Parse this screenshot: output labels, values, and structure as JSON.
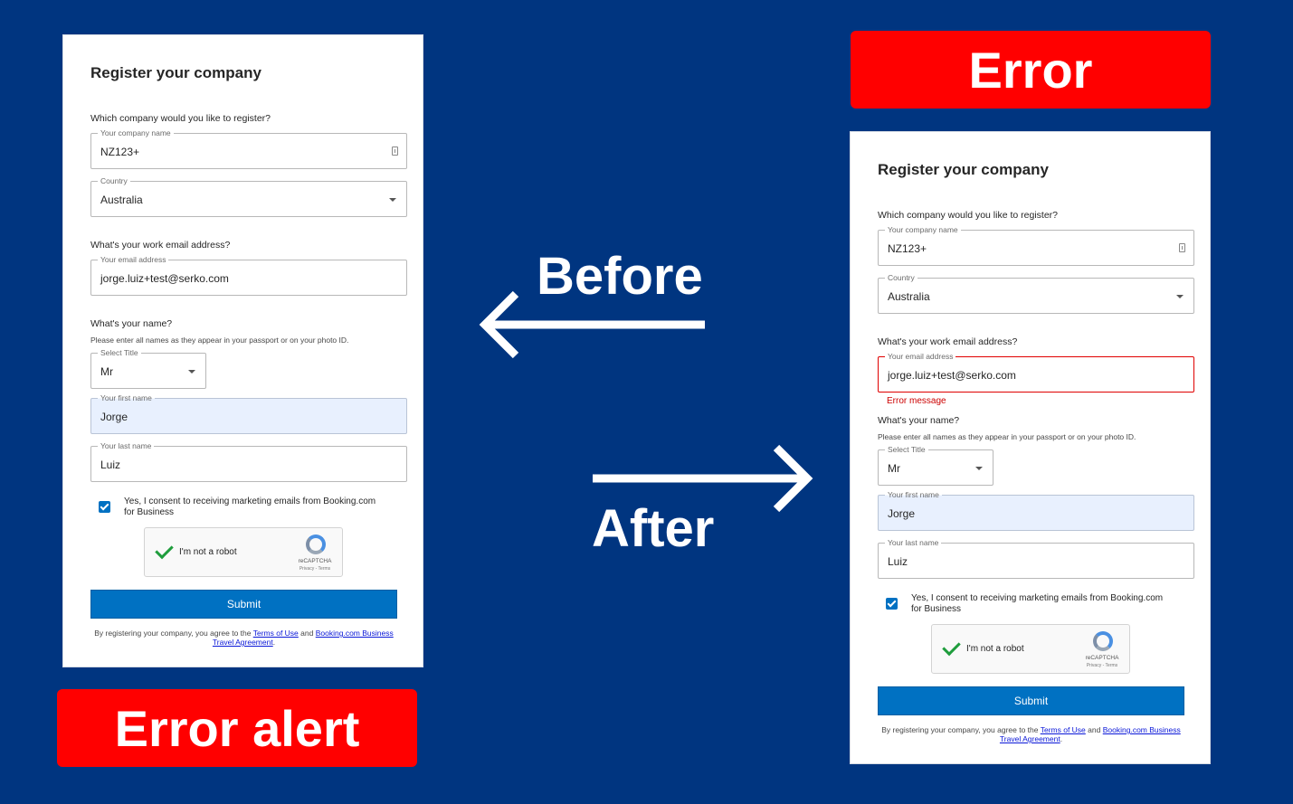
{
  "colors": {
    "background": "#003580",
    "banner": "#ff0000",
    "primary": "#0071c2",
    "error": "#cc0000"
  },
  "labels": {
    "error_banner": "Error",
    "error_alert_banner": "Error alert",
    "before": "Before",
    "after": "After"
  },
  "form": {
    "title": "Register your company",
    "company_question": "Which company would you like to register?",
    "company_label": "Your company name",
    "company_value": "NZ123+",
    "country_label": "Country",
    "country_value": "Australia",
    "email_question": "What's your work email address?",
    "email_label": "Your email address",
    "email_value": "jorge.luiz+test@serko.com",
    "error_message": "Error message",
    "name_question": "What's your name?",
    "name_hint": "Please enter all names as they appear in your passport or on your photo ID.",
    "title_label": "Select Title",
    "title_value": "Mr",
    "first_name_label": "Your first name",
    "first_name_value": "Jorge",
    "last_name_label": "Your last name",
    "last_name_value": "Luiz",
    "consent": "Yes, I consent to receiving marketing emails from Booking.com for Business",
    "consent_checked": true,
    "captcha_text": "I'm not a robot",
    "captcha_brand": "reCAPTCHA",
    "captcha_links": "Privacy - Terms",
    "submit": "Submit",
    "terms_prefix": "By registering your company, you agree to the",
    "terms_link": "Terms of Use",
    "terms_and": "and",
    "terms_link2": "Booking.com Business Travel Agreement",
    "terms_suffix": "."
  }
}
